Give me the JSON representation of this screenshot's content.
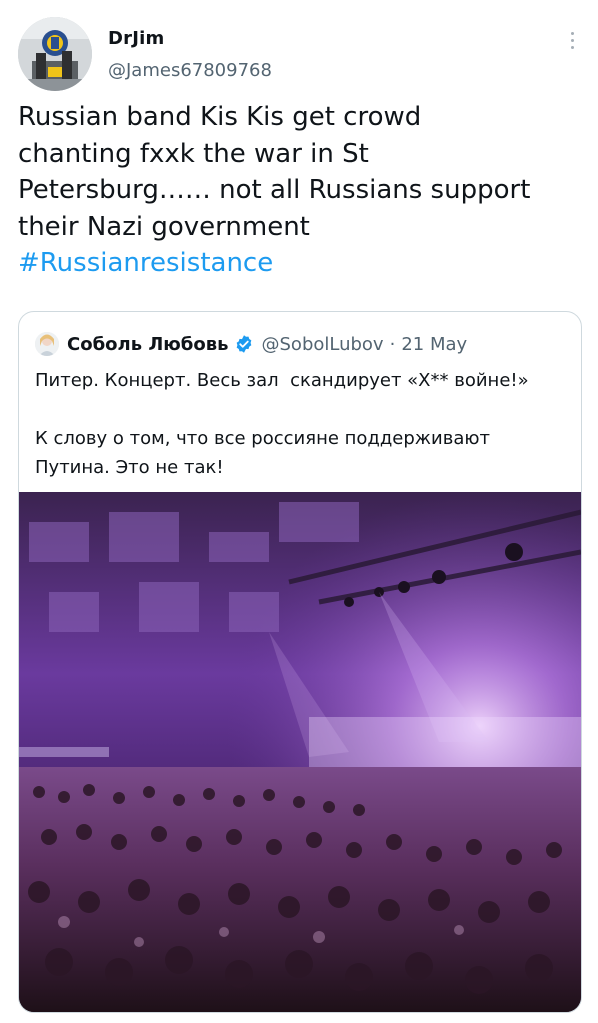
{
  "author": {
    "display_name": "DrJim",
    "handle": "@James67809768"
  },
  "tweet": {
    "text": "Russian band Kis Kis get crowd\nchanting fxxk the war in St\nPetersburg…… not all Russians support\ntheir Nazi government",
    "hashtag": "#Russianresistance"
  },
  "quoted_tweet": {
    "display_name": "Соболь Любовь",
    "verified": true,
    "handle": "@SobolLubov",
    "separator": "·",
    "date": "21 May",
    "text": "Питер. Концерт. Весь зал  скандирует «Х** войне!»\n\nК слову о том, что все россияне поддерживают\nПутина. Это не так!"
  },
  "icons": {
    "more": "more-vertical-icon",
    "verified": "verified-badge-icon"
  },
  "colors": {
    "text": "#0f1419",
    "secondary": "#536471",
    "link": "#1d9bf0",
    "border": "#cfd9de",
    "concert_purple": "#7a3fb0"
  }
}
